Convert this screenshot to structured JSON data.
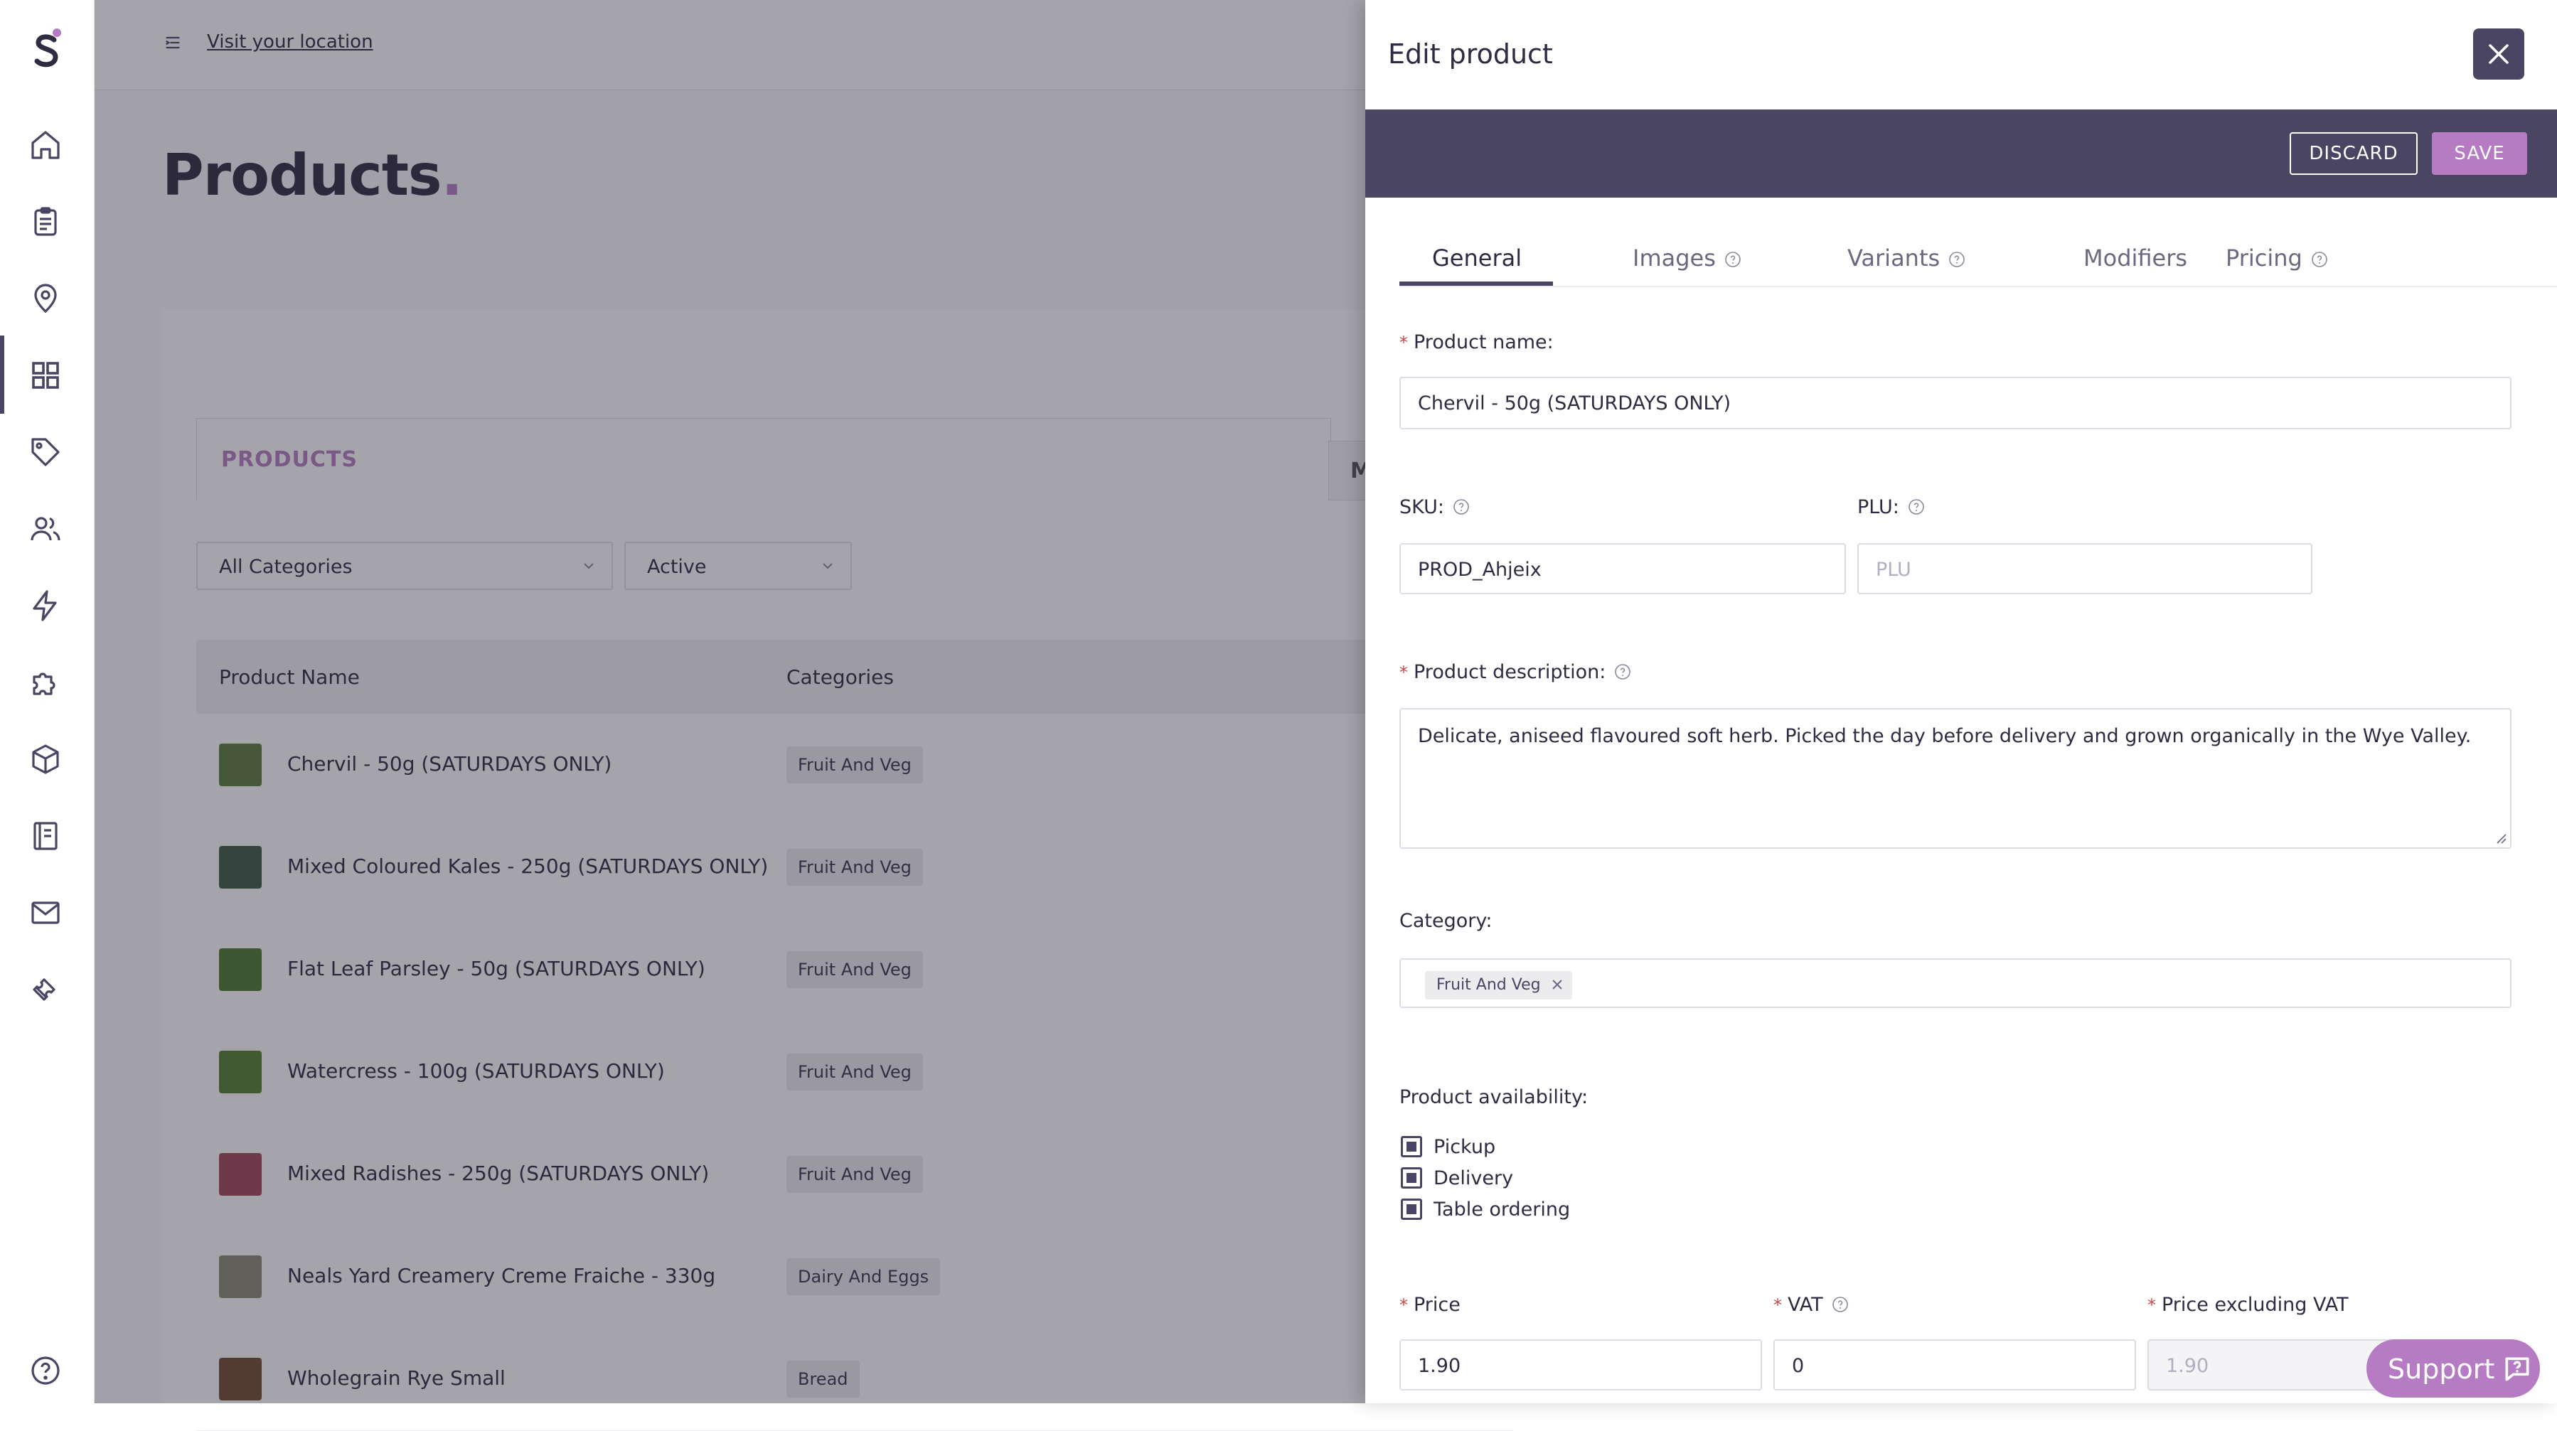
{
  "sidebar": {
    "logo": "S",
    "items": [
      {
        "icon": "home-icon"
      },
      {
        "icon": "clipboard-icon"
      },
      {
        "icon": "map-pin-icon"
      },
      {
        "icon": "grid-icon"
      },
      {
        "icon": "tag-icon"
      },
      {
        "icon": "users-icon"
      },
      {
        "icon": "lightning-icon"
      },
      {
        "icon": "puzzle-icon"
      },
      {
        "icon": "box-icon"
      },
      {
        "icon": "book-icon"
      },
      {
        "icon": "mail-icon"
      },
      {
        "icon": "ticket-icon"
      },
      {
        "icon": "help-circle-icon"
      }
    ]
  },
  "topbar": {
    "visit_link": "Visit your location"
  },
  "page": {
    "title": "Products",
    "title_dot": ".",
    "tab_products": "PRODUCTS",
    "tab_more": "M",
    "filter_category": "All Categories",
    "filter_status": "Active",
    "columns": [
      "Product Name",
      "Categories"
    ],
    "rows": [
      {
        "name": "Chervil - 50g (SATURDAYS ONLY)",
        "category": "Fruit And Veg",
        "thumb_color": "#5d7d3a"
      },
      {
        "name": "Mixed Coloured Kales - 250g (SATURDAYS ONLY)",
        "category": "Fruit And Veg",
        "thumb_color": "#3f5a45"
      },
      {
        "name": "Flat Leaf Parsley - 50g (SATURDAYS ONLY)",
        "category": "Fruit And Veg",
        "thumb_color": "#4d7a2f"
      },
      {
        "name": "Watercress - 100g (SATURDAYS ONLY)",
        "category": "Fruit And Veg",
        "thumb_color": "#54802f"
      },
      {
        "name": "Mixed Radishes - 250g (SATURDAYS ONLY)",
        "category": "Fruit And Veg",
        "thumb_color": "#a2475a"
      },
      {
        "name": "Neals Yard Creamery Creme Fraiche - 330g",
        "category": "Dairy And Eggs",
        "thumb_color": "#8a8a70"
      },
      {
        "name": "Wholegrain Rye Small",
        "category": "Bread",
        "thumb_color": "#6e4a30"
      }
    ]
  },
  "panel": {
    "title": "Edit product",
    "discard_label": "DISCARD",
    "save_label": "SAVE",
    "tabs": [
      "General",
      "Images",
      "Variants",
      "Modifiers",
      "Pricing"
    ],
    "product_name_label": "Product name:",
    "product_name": "Chervil - 50g (SATURDAYS ONLY)",
    "sku_label": "SKU:",
    "sku": "PROD_Ahjeix",
    "plu_label": "PLU:",
    "plu_placeholder": "PLU",
    "description_label": "Product description:",
    "description": "Delicate, aniseed flavoured soft herb. Picked the day before delivery and grown organically in the Wye Valley.",
    "category_label": "Category:",
    "category_chip": "Fruit And Veg",
    "availability_label": "Product availability:",
    "availability": [
      {
        "label": "Pickup",
        "checked": true
      },
      {
        "label": "Delivery",
        "checked": true
      },
      {
        "label": "Table ordering",
        "checked": true
      }
    ],
    "price_label": "Price",
    "price": "1.90",
    "vat_label": "VAT",
    "vat": "0",
    "price_ex_vat_label": "Price excluding VAT",
    "price_ex_vat_placeholder": "1.90",
    "required_mark": "*"
  },
  "support": {
    "label": "Support"
  },
  "colors": {
    "brand": "#4a4563",
    "accent": "#b57cc3",
    "required": "#d04848"
  }
}
